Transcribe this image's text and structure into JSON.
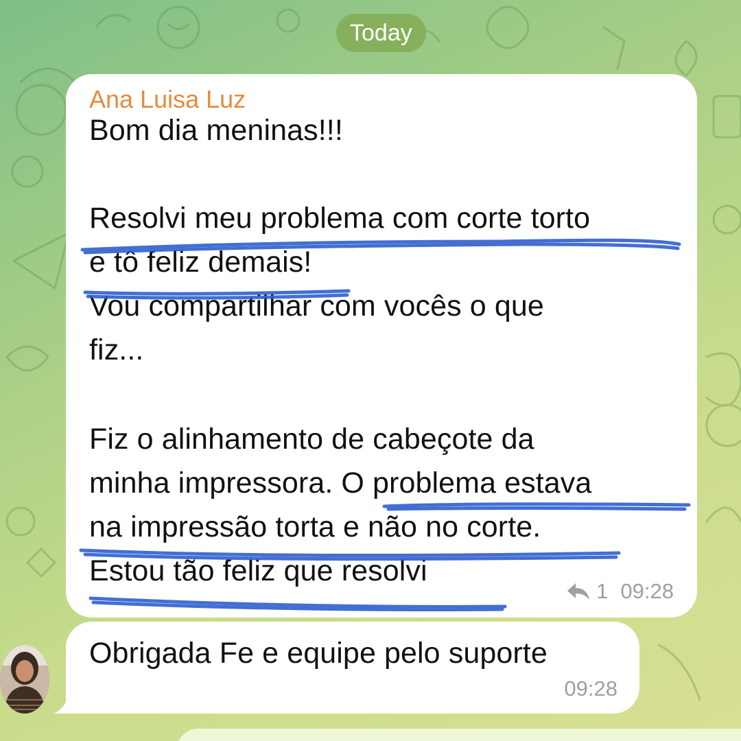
{
  "chat": {
    "date_label": "Today",
    "messages": [
      {
        "sender": "Ana Luisa Luz",
        "lines": [
          "Bom dia meninas!!!",
          "",
          "Resolvi meu problema com corte torto",
          "e tô feliz demais!",
          "Vou compartilhar com vocês o que",
          "fiz...",
          "",
          "Fiz o alinhamento de cabeçote da",
          "minha impressora. O problema estava",
          "na impressão torta e não no corte.",
          "Estou tão feliz que resolvi"
        ],
        "reply_count": "1",
        "time": "09:28"
      },
      {
        "lines": [
          "Obrigada Fe e equipe pelo suporte"
        ],
        "time": "09:28"
      }
    ]
  },
  "colors": {
    "sender_name": "#e68a3a",
    "underline": "#2f5fd0",
    "date_pill": "#86b05c",
    "meta": "#9aa0a6"
  },
  "icons": {
    "reply": "reply-arrow-icon",
    "avatar": "user-avatar"
  }
}
